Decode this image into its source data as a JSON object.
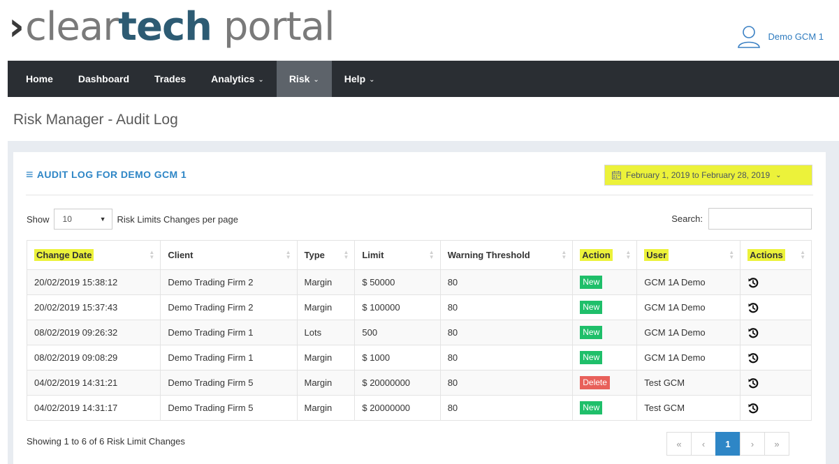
{
  "header": {
    "logo_chevron": "›",
    "logo_part1": "clear",
    "logo_part2": "tech",
    "logo_part3": " portal",
    "user_name": "Demo GCM 1"
  },
  "nav": [
    {
      "label": "Home",
      "has_caret": false,
      "active": false
    },
    {
      "label": "Dashboard",
      "has_caret": false,
      "active": false
    },
    {
      "label": "Trades",
      "has_caret": false,
      "active": false
    },
    {
      "label": "Analytics",
      "has_caret": true,
      "active": false
    },
    {
      "label": "Risk",
      "has_caret": true,
      "active": true
    },
    {
      "label": "Help",
      "has_caret": true,
      "active": false
    }
  ],
  "page_title": "Risk Manager - Audit Log",
  "panel": {
    "title": "AUDIT LOG FOR DEMO GCM 1",
    "date_range": "February 1, 2019 to February 28, 2019"
  },
  "controls": {
    "show_label": "Show",
    "page_size": "10",
    "per_page_label": "Risk Limits Changes per page",
    "search_label": "Search:"
  },
  "table": {
    "headers": [
      "Change Date",
      "Client",
      "Type",
      "Limit",
      "Warning Threshold",
      "Action",
      "User",
      "Actions"
    ],
    "rows": [
      {
        "date": "20/02/2019 15:38:12",
        "client": "Demo Trading Firm 2",
        "type": "Margin",
        "limit": "$ 50000",
        "threshold": "80",
        "action": "New",
        "user": "GCM 1A Demo"
      },
      {
        "date": "20/02/2019 15:37:43",
        "client": "Demo Trading Firm 2",
        "type": "Margin",
        "limit": "$ 100000",
        "threshold": "80",
        "action": "New",
        "user": "GCM 1A Demo"
      },
      {
        "date": "08/02/2019 09:26:32",
        "client": "Demo Trading Firm 1",
        "type": "Lots",
        "limit": "500",
        "threshold": "80",
        "action": "New",
        "user": "GCM 1A Demo"
      },
      {
        "date": "08/02/2019 09:08:29",
        "client": "Demo Trading Firm 1",
        "type": "Margin",
        "limit": "$ 1000",
        "threshold": "80",
        "action": "New",
        "user": "GCM 1A Demo"
      },
      {
        "date": "04/02/2019 14:31:21",
        "client": "Demo Trading Firm 5",
        "type": "Margin",
        "limit": "$ 20000000",
        "threshold": "80",
        "action": "Delete",
        "user": "Test GCM"
      },
      {
        "date": "04/02/2019 14:31:17",
        "client": "Demo Trading Firm 5",
        "type": "Margin",
        "limit": "$ 20000000",
        "threshold": "80",
        "action": "New",
        "user": "Test GCM"
      }
    ]
  },
  "footer": {
    "info": "Showing 1 to 6 of 6 Risk Limit Changes",
    "pages": [
      "«",
      "‹",
      "1",
      "›",
      "»"
    ],
    "current_page": "1"
  },
  "colors": {
    "highlight": "#ecf23a",
    "nav_bg": "#2a2e33",
    "nav_active": "#5d636a",
    "accent": "#2e86c6",
    "badge_new": "#1fbf6a",
    "badge_delete": "#e8605a"
  },
  "icons": {
    "user": "user-outline-icon",
    "menu": "hamburger-menu-icon",
    "calendar": "calendar-icon",
    "undo": "undo-history-icon"
  }
}
